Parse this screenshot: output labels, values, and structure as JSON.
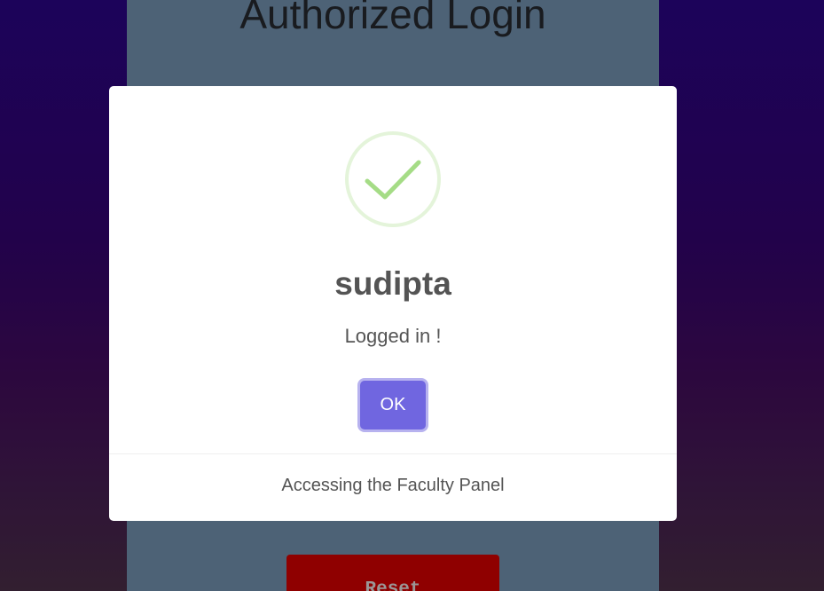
{
  "login_page": {
    "title": "Authorized Login",
    "reset_label": "Reset"
  },
  "dialog": {
    "icon": "success-check-icon",
    "title": "sudipta",
    "text": "Logged in !",
    "confirm_label": "OK",
    "footer_text": "Accessing the Faculty Panel"
  },
  "colors": {
    "confirm_button": "#7066e0",
    "success_icon": "#a5dc86",
    "reset_button": "#9c0000",
    "panel": "#546b80"
  }
}
